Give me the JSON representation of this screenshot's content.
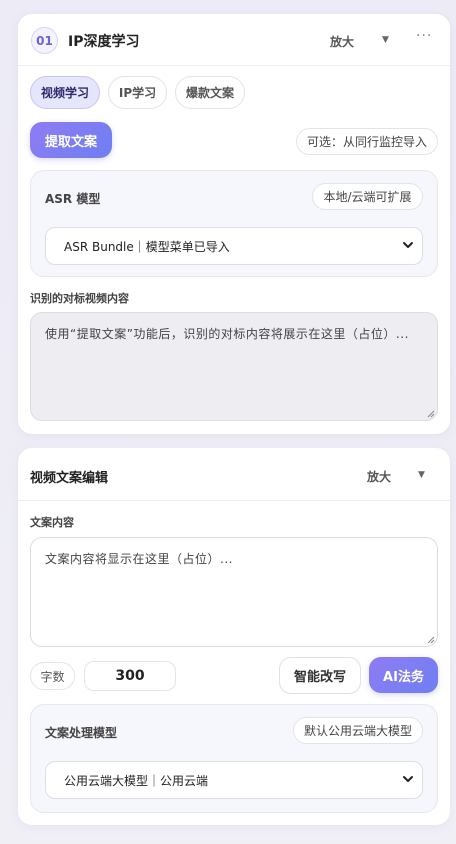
{
  "card1": {
    "badge": "01",
    "title": "IP深度学习",
    "zoom_label": "放大",
    "more_label": "···",
    "tabs": [
      {
        "label": "视频学习",
        "active": true
      },
      {
        "label": "IP学习",
        "active": false
      },
      {
        "label": "爆款文案",
        "active": false
      }
    ],
    "extract_button": "提取文案",
    "import_option": "可选：从同行监控导入",
    "asr": {
      "label": "ASR 模型",
      "tag": "本地/云端可扩展",
      "selected": "ASR Bundle｜模型菜单已导入"
    },
    "recognized": {
      "label": "识别的对标视频内容",
      "placeholder": "使用“提取文案”功能后，识别的对标内容将展示在这里（占位）..."
    }
  },
  "card2": {
    "title": "视频文案编辑",
    "zoom_label": "放大",
    "content": {
      "label": "文案内容",
      "placeholder": "文案内容将显示在这里（占位）..."
    },
    "word_count_label": "字数",
    "word_count_value": "300",
    "rewrite_button": "智能改写",
    "ai_button": "AI法务",
    "model": {
      "label": "文案处理模型",
      "tag": "默认公用云端大模型",
      "selected": "公用云端大模型｜公用云端"
    }
  },
  "colors": {
    "accent_start": "#8f7cf4",
    "accent_end": "#6e7ff1",
    "active_tab_bg": "#e5e5fb",
    "page_bg": "#ecebf6"
  },
  "icons": {
    "dropdown": "caret-down-icon",
    "more": "more-icon",
    "select": "chevron-down-icon",
    "resize": "resize-handle-icon"
  }
}
